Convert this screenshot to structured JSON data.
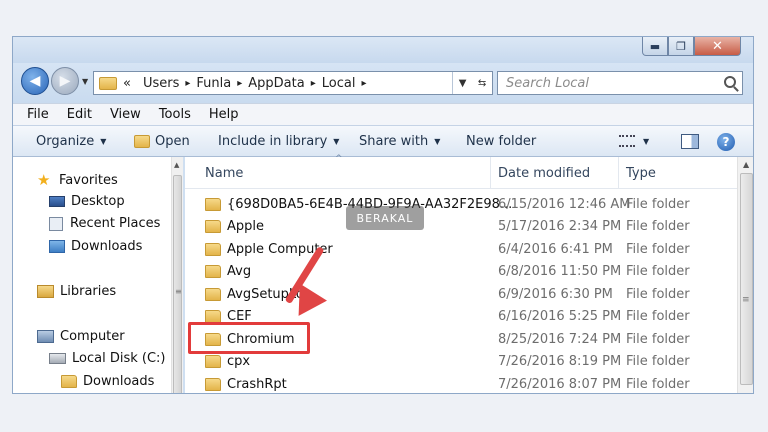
{
  "window": {
    "minimize": "▬",
    "maximize": "❐",
    "close": "✕"
  },
  "address": {
    "overflow": "«",
    "crumbs": [
      "Users",
      "Funla",
      "AppData",
      "Local"
    ],
    "separator": "▸"
  },
  "search": {
    "placeholder": "Search Local"
  },
  "menu": [
    "File",
    "Edit",
    "View",
    "Tools",
    "Help"
  ],
  "toolbar": {
    "organize": "Organize",
    "open": "Open",
    "include": "Include in library",
    "share": "Share with",
    "new_folder": "New folder",
    "help": "?"
  },
  "nav": {
    "favorites": "Favorites",
    "desktop": "Desktop",
    "recent": "Recent Places",
    "downloads": "Downloads",
    "libraries": "Libraries",
    "computer": "Computer",
    "local_disk": "Local Disk (C:)",
    "downloads2": "Downloads"
  },
  "columns": {
    "name": "Name",
    "date": "Date modified",
    "type": "Type"
  },
  "files": [
    {
      "name": "{698D0BA5-6E4B-44BD-9F9A-AA32F2E98...",
      "date": "6/15/2016 12:46 AM",
      "type": "File folder"
    },
    {
      "name": "Apple",
      "date": "5/17/2016 2:34 PM",
      "type": "File folder"
    },
    {
      "name": "Apple Computer",
      "date": "6/4/2016 6:41 PM",
      "type": "File folder"
    },
    {
      "name": "Avg",
      "date": "6/8/2016 11:50 PM",
      "type": "File folder"
    },
    {
      "name": "AvgSetupLo",
      "date": "6/9/2016 6:30 PM",
      "type": "File folder"
    },
    {
      "name": "CEF",
      "date": "6/16/2016 5:25 PM",
      "type": "File folder"
    },
    {
      "name": "Chromium",
      "date": "8/25/2016 7:24 PM",
      "type": "File folder"
    },
    {
      "name": "cpx",
      "date": "7/26/2016 8:19 PM",
      "type": "File folder"
    },
    {
      "name": "CrashRpt",
      "date": "7/26/2016 8:07 PM",
      "type": "File folder"
    }
  ],
  "watermark": "BERAKAL"
}
